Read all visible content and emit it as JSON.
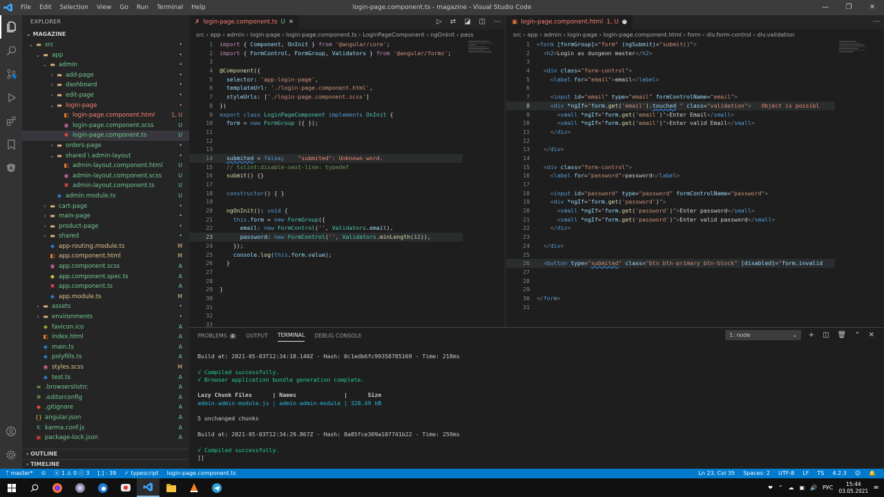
{
  "window": {
    "title": "login-page.component.ts - magazine - Visual Studio Code",
    "menu": [
      "File",
      "Edit",
      "Selection",
      "View",
      "Go",
      "Run",
      "Terminal",
      "Help"
    ]
  },
  "sidebar": {
    "header": "EXPLORER",
    "project": "MAGAZINE",
    "items": [
      {
        "label": "src",
        "depth": 0,
        "kind": "folder-open",
        "color": "#73c991",
        "badge": "•",
        "badge_color": "#73c991"
      },
      {
        "label": "app",
        "depth": 1,
        "kind": "folder-open",
        "color": "#73c991",
        "badge": "•",
        "badge_color": "#73c991"
      },
      {
        "label": "admin",
        "depth": 2,
        "kind": "folder-open",
        "color": "#73c991",
        "badge": "•",
        "badge_color": "#73c991"
      },
      {
        "label": "add-page",
        "depth": 3,
        "kind": "folder",
        "color": "#73c991",
        "badge": "•",
        "badge_color": "#73c991"
      },
      {
        "label": "dashboard",
        "depth": 3,
        "kind": "folder",
        "color": "#73c991",
        "badge": "•",
        "badge_color": "#73c991"
      },
      {
        "label": "edit-page",
        "depth": 3,
        "kind": "folder",
        "color": "#73c991",
        "badge": "•",
        "badge_color": "#73c991"
      },
      {
        "label": "login-page",
        "depth": 3,
        "kind": "folder-open",
        "color": "#f88070",
        "badge": "•",
        "badge_color": "#f88070"
      },
      {
        "label": "login-page.component.html",
        "depth": 4,
        "kind": "html",
        "color": "#f88070",
        "badge": "1, U",
        "badge_color": "#f88070"
      },
      {
        "label": "login-page.component.scss",
        "depth": 4,
        "kind": "scss",
        "color": "#73c991",
        "badge": "U",
        "badge_color": "#73c991"
      },
      {
        "label": "login-page.component.ts",
        "depth": 4,
        "kind": "ts-err",
        "color": "#73c991",
        "badge": "U",
        "badge_color": "#73c991",
        "selected": true
      },
      {
        "label": "orders-page",
        "depth": 3,
        "kind": "folder",
        "color": "#73c991",
        "badge": "•",
        "badge_color": "#73c991"
      },
      {
        "label": "shared \\ admin-layout",
        "depth": 3,
        "kind": "folder-open",
        "color": "#73c991",
        "badge": "•",
        "badge_color": "#73c991"
      },
      {
        "label": "admin-layout.component.html",
        "depth": 4,
        "kind": "html",
        "color": "#73c991",
        "badge": "U",
        "badge_color": "#73c991"
      },
      {
        "label": "admin-layout.component.scss",
        "depth": 4,
        "kind": "scss",
        "color": "#73c991",
        "badge": "U",
        "badge_color": "#73c991"
      },
      {
        "label": "admin-layout.component.ts",
        "depth": 4,
        "kind": "ts-err",
        "color": "#73c991",
        "badge": "U",
        "badge_color": "#73c991"
      },
      {
        "label": "admin.module.ts",
        "depth": 3,
        "kind": "ts",
        "color": "#73c991",
        "badge": "U",
        "badge_color": "#73c991"
      },
      {
        "label": "cart-page",
        "depth": 2,
        "kind": "folder",
        "color": "#73c991",
        "badge": "•",
        "badge_color": "#73c991"
      },
      {
        "label": "main-page",
        "depth": 2,
        "kind": "folder",
        "color": "#73c991",
        "badge": "•",
        "badge_color": "#73c991"
      },
      {
        "label": "product-page",
        "depth": 2,
        "kind": "folder",
        "color": "#73c991",
        "badge": "•",
        "badge_color": "#73c991"
      },
      {
        "label": "shared",
        "depth": 2,
        "kind": "folder",
        "color": "#73c991",
        "badge": "•",
        "badge_color": "#73c991"
      },
      {
        "label": "app-routing.module.ts",
        "depth": 2,
        "kind": "ts",
        "color": "#e2c08d",
        "badge": "M",
        "badge_color": "#e2c08d"
      },
      {
        "label": "app.component.html",
        "depth": 2,
        "kind": "html",
        "color": "#e2c08d",
        "badge": "M",
        "badge_color": "#e2c08d"
      },
      {
        "label": "app.component.scss",
        "depth": 2,
        "kind": "scss",
        "color": "#73c991",
        "badge": "A",
        "badge_color": "#73c991"
      },
      {
        "label": "app.component.spec.ts",
        "depth": 2,
        "kind": "spec",
        "color": "#73c991",
        "badge": "A",
        "badge_color": "#73c991"
      },
      {
        "label": "app.component.ts",
        "depth": 2,
        "kind": "ts-err",
        "color": "#73c991",
        "badge": "A",
        "badge_color": "#73c991"
      },
      {
        "label": "app.module.ts",
        "depth": 2,
        "kind": "ts",
        "color": "#e2c08d",
        "badge": "M",
        "badge_color": "#e2c08d"
      },
      {
        "label": "assets",
        "depth": 1,
        "kind": "folder",
        "color": "#73c991",
        "badge": "•",
        "badge_color": "#73c991"
      },
      {
        "label": "environments",
        "depth": 1,
        "kind": "folder",
        "color": "#73c991",
        "badge": "•",
        "badge_color": "#73c991"
      },
      {
        "label": "favicon.ico",
        "depth": 1,
        "kind": "ico",
        "color": "#73c991",
        "badge": "A",
        "badge_color": "#73c991"
      },
      {
        "label": "index.html",
        "depth": 1,
        "kind": "html",
        "color": "#73c991",
        "badge": "A",
        "badge_color": "#73c991"
      },
      {
        "label": "main.ts",
        "depth": 1,
        "kind": "ts",
        "color": "#73c991",
        "badge": "A",
        "badge_color": "#73c991"
      },
      {
        "label": "polyfills.ts",
        "depth": 1,
        "kind": "ts",
        "color": "#73c991",
        "badge": "A",
        "badge_color": "#73c991"
      },
      {
        "label": "styles.scss",
        "depth": 1,
        "kind": "scss",
        "color": "#e2c08d",
        "badge": "M",
        "badge_color": "#e2c08d"
      },
      {
        "label": "test.ts",
        "depth": 1,
        "kind": "ts",
        "color": "#73c991",
        "badge": "A",
        "badge_color": "#73c991"
      },
      {
        "label": ".browserslistrc",
        "depth": 0,
        "kind": "cfg",
        "color": "#73c991",
        "badge": "A",
        "badge_color": "#73c991"
      },
      {
        "label": ".editorconfig",
        "depth": 0,
        "kind": "gear",
        "color": "#73c991",
        "badge": "A",
        "badge_color": "#73c991"
      },
      {
        "label": ".gitignore",
        "depth": 0,
        "kind": "git",
        "color": "#73c991",
        "badge": "A",
        "badge_color": "#73c991"
      },
      {
        "label": "angular.json",
        "depth": 0,
        "kind": "json",
        "color": "#73c991",
        "badge": "A",
        "badge_color": "#73c991"
      },
      {
        "label": "karma.conf.js",
        "depth": 0,
        "kind": "karma",
        "color": "#73c991",
        "badge": "A",
        "badge_color": "#73c991"
      },
      {
        "label": "package-lock.json",
        "depth": 0,
        "kind": "npm",
        "color": "#73c991",
        "badge": "A",
        "badge_color": "#73c991"
      }
    ],
    "outline": "OUTLINE",
    "timeline": "TIMELINE"
  },
  "left_editor": {
    "tab": "login-page.component.ts",
    "tab_badge": "U",
    "breadcrumb": [
      "src",
      "app",
      "admin",
      "login-page",
      "login-page.component.ts",
      "LoginPageComponent",
      "ngOnInit",
      "pass"
    ],
    "line_numbers": [
      "1",
      "2",
      "3",
      "4",
      "5",
      "6",
      "7",
      "8",
      "9",
      "10",
      "11",
      "12",
      "13",
      "14",
      "15",
      "16",
      "17",
      "18",
      "19",
      "20",
      "21",
      "22",
      "23",
      "24",
      "25",
      "26",
      "27",
      "28",
      "29",
      "30",
      "31",
      "32",
      "33"
    ],
    "current_line": "23"
  },
  "right_editor": {
    "tab": "login-page.component.html",
    "tab_badge": "1, U",
    "breadcrumb": [
      "src",
      "app",
      "admin",
      "login-page",
      "login-page.component.html",
      "form",
      "div.form-control",
      "div.validation"
    ],
    "line_numbers": [
      "1",
      "2",
      "3",
      "4",
      "5",
      "6",
      "7",
      "8",
      "9",
      "10",
      "11",
      "12",
      "13",
      "14",
      "15",
      "16",
      "17",
      "18",
      "19",
      "20",
      "21",
      "22",
      "23",
      "24",
      "25",
      "26",
      "27",
      "28",
      "29",
      "30",
      "31"
    ],
    "current_line": "8",
    "error_hint": "Object is possibl"
  },
  "panel": {
    "tabs": [
      "PROBLEMS",
      "OUTPUT",
      "TERMINAL",
      "DEBUG CONSOLE"
    ],
    "problems_count": "4",
    "active_tab": "TERMINAL",
    "terminal_select": "1: node",
    "lines": [
      "Build at: 2021-05-03T12:34:18.140Z - Hash: 0c1edb6fc99358785169 - Time: 218ms",
      "",
      "√ Compiled successfully.",
      "√ Browser application bundle generation complete.",
      "",
      "Lazy Chunk Files      | Names              |      Size",
      "admin-admin-module.js | admin-admin-module | 328.49 kB",
      "",
      "5 unchanged chunks",
      "",
      "Build at: 2021-05-03T12:34:29.867Z - Hash: 8a85fce309a107741b22 - Time: 259ms",
      "",
      "√ Compiled successfully.",
      "[]"
    ]
  },
  "statusbar": {
    "branch": "master*",
    "sync": "⊙",
    "errors": "1",
    "warnings": "0",
    "info": "3",
    "selection": "[.] : 39",
    "lang_icon": "✓ typescript",
    "file": "login-page.component.ts",
    "position": "Ln 23, Col 35",
    "spaces": "Spaces: 2",
    "encoding": "UTF-8",
    "eol": "LF",
    "language": "TS",
    "version": "4.2.3"
  },
  "taskbar": {
    "lang": "РУС",
    "time": "15:44",
    "date": "03.05.2021"
  },
  "colors": {
    "accent": "#007acc",
    "added": "#73c991",
    "modified": "#e2c08d",
    "error": "#f88070"
  }
}
